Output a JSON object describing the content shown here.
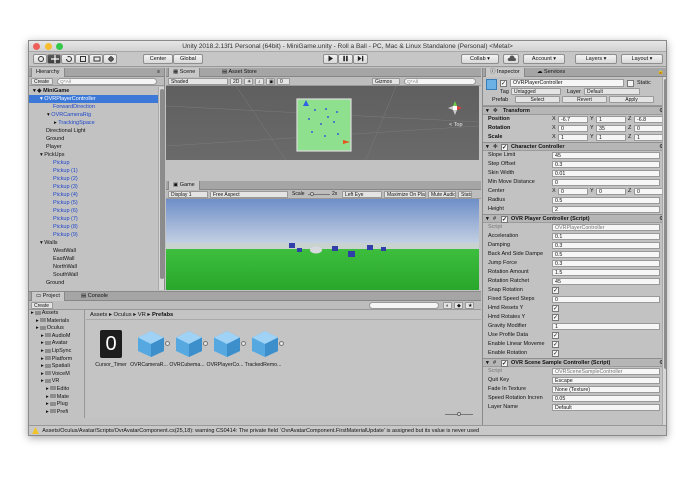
{
  "window": {
    "title": "Unity 2018.2.13f1 Personal (64bit) - MiniGame.unity - Roll a Ball - PC, Mac & Linux Standalone (Personal) <Metal>",
    "colors": {
      "close": "#ee5f58",
      "minimize": "#f8bd2e",
      "maximize": "#34c84a"
    }
  },
  "toolbar": {
    "center": "Center",
    "global": "Global",
    "collab": "Collab",
    "account": "Account",
    "layers": "Layers",
    "layout": "Layout"
  },
  "hierarchy": {
    "tab": "Hierarchy",
    "create": "Create",
    "search_placeholder": "Q*All",
    "items": [
      {
        "label": "MiniGame",
        "indent": 0,
        "style": "scene"
      },
      {
        "label": "OVRPlayerController",
        "indent": 1,
        "style": "selected"
      },
      {
        "label": "ForwardDirection",
        "indent": 2,
        "style": "blue"
      },
      {
        "label": "OVRCameraRig",
        "indent": 2,
        "style": "blue"
      },
      {
        "label": "TrackingSpace",
        "indent": 3,
        "style": "blue"
      },
      {
        "label": "Directional Light",
        "indent": 1,
        "style": "normal"
      },
      {
        "label": "Ground",
        "indent": 1,
        "style": "normal"
      },
      {
        "label": "Player",
        "indent": 1,
        "style": "normal"
      },
      {
        "label": "PickUps",
        "indent": 1,
        "style": "normal"
      },
      {
        "label": "Pickup",
        "indent": 2,
        "style": "blue"
      },
      {
        "label": "Pickup (1)",
        "indent": 2,
        "style": "blue"
      },
      {
        "label": "Pickup (2)",
        "indent": 2,
        "style": "blue"
      },
      {
        "label": "Pickup (3)",
        "indent": 2,
        "style": "blue"
      },
      {
        "label": "Pickup (4)",
        "indent": 2,
        "style": "blue"
      },
      {
        "label": "Pickup (5)",
        "indent": 2,
        "style": "blue"
      },
      {
        "label": "Pickup (6)",
        "indent": 2,
        "style": "blue"
      },
      {
        "label": "Pickup (7)",
        "indent": 2,
        "style": "blue"
      },
      {
        "label": "Pickup (8)",
        "indent": 2,
        "style": "blue"
      },
      {
        "label": "Pickup (9)",
        "indent": 2,
        "style": "blue"
      },
      {
        "label": "Walls",
        "indent": 1,
        "style": "normal"
      },
      {
        "label": "WestWall",
        "indent": 2,
        "style": "normal"
      },
      {
        "label": "EastWall",
        "indent": 2,
        "style": "normal"
      },
      {
        "label": "NorthWall",
        "indent": 2,
        "style": "normal"
      },
      {
        "label": "SouthWall",
        "indent": 2,
        "style": "normal"
      },
      {
        "label": "Ground",
        "indent": 1,
        "style": "normal"
      }
    ]
  },
  "scene": {
    "tab_scene": "Scene",
    "tab_asset_store": "Asset Store",
    "shading": "Shaded",
    "mode_2d": "2D",
    "gizmos": "Gizmos",
    "search_placeholder": "Q*All",
    "gizmo_label": "< Top"
  },
  "game": {
    "tab": "Game",
    "display": "Display 1",
    "aspect": "Free Aspect",
    "scale_label": "Scale",
    "scale_value": "2x",
    "left_eye": "Left Eye",
    "maximize": "Maximize On Play",
    "mute": "Mute Audio",
    "stats": "Stats"
  },
  "project": {
    "tab_project": "Project",
    "tab_console": "Console",
    "create": "Create",
    "tree": [
      {
        "label": "Assets",
        "indent": 0
      },
      {
        "label": "Materials",
        "indent": 1
      },
      {
        "label": "Oculus",
        "indent": 1
      },
      {
        "label": "AudioM",
        "indent": 2
      },
      {
        "label": "Avatar",
        "indent": 2
      },
      {
        "label": "LipSync",
        "indent": 2
      },
      {
        "label": "Platform",
        "indent": 2
      },
      {
        "label": "Spatiali",
        "indent": 2
      },
      {
        "label": "VoiceM",
        "indent": 2
      },
      {
        "label": "VR",
        "indent": 2
      },
      {
        "label": "Edito",
        "indent": 3
      },
      {
        "label": "Mate",
        "indent": 3
      },
      {
        "label": "Plug",
        "indent": 3
      },
      {
        "label": "Prefi",
        "indent": 3
      }
    ],
    "breadcrumb": [
      "Assets",
      "Oculus",
      "VR",
      "Prefabs"
    ],
    "assets": [
      {
        "label": "Cursor_Timer",
        "icon": "timer-icon"
      },
      {
        "label": "OVRCameraR...",
        "icon": "prefab-cube-icon"
      },
      {
        "label": "OVRCubema...",
        "icon": "prefab-cube-icon"
      },
      {
        "label": "OVRPlayerCo...",
        "icon": "prefab-cube-icon"
      },
      {
        "label": "TrackedRemo...",
        "icon": "prefab-cube-icon"
      }
    ],
    "timer_glyph": "0"
  },
  "inspector": {
    "tab_inspector": "Inspector",
    "tab_services": "Services",
    "object_name": "OVRPlayerController",
    "static_label": "Static",
    "tag_label": "Tag",
    "tag_value": "Untagged",
    "layer_label": "Layer",
    "layer_value": "Default",
    "prefab_label": "Prefab",
    "select": "Select",
    "revert": "Revert",
    "apply": "Apply",
    "transform": {
      "title": "Transform",
      "position_label": "Position",
      "rotation_label": "Rotation",
      "scale_label": "Scale",
      "position": {
        "x": "-6.7",
        "y": "1",
        "z": "-6.8"
      },
      "rotation": {
        "x": "0",
        "y": "35",
        "z": "0"
      },
      "scale": {
        "x": "1",
        "y": "1",
        "z": "1"
      }
    },
    "character_controller": {
      "title": "Character Controller",
      "props": [
        {
          "label": "Slope Limit",
          "value": "45"
        },
        {
          "label": "Step Offset",
          "value": "0.3"
        },
        {
          "label": "Skin Width",
          "value": "0.01"
        },
        {
          "label": "Min Move Distance",
          "value": "0"
        }
      ],
      "center_label": "Center",
      "center": {
        "x": "0",
        "y": "0",
        "z": "0"
      },
      "props2": [
        {
          "label": "Radius",
          "value": "0.5"
        },
        {
          "label": "Height",
          "value": "2"
        }
      ]
    },
    "ovr_player_controller": {
      "title": "OVR Player Controller (Script)",
      "script_label": "Script",
      "script_value": "OVRPlayerController",
      "props": [
        {
          "label": "Acceleration",
          "value": "0.1"
        },
        {
          "label": "Damping",
          "value": "0.3"
        },
        {
          "label": "Back And Side Dampe",
          "value": "0.5"
        },
        {
          "label": "Jump Force",
          "value": "0.3"
        },
        {
          "label": "Rotation Amount",
          "value": "1.5"
        },
        {
          "label": "Rotation Ratchet",
          "value": "45"
        }
      ],
      "checks": [
        {
          "label": "Snap Rotation",
          "checked": true
        },
        {
          "label": "Fixed Speed Steps",
          "value": "0"
        },
        {
          "label": "Hmd Resets Y",
          "checked": true
        },
        {
          "label": "Hmd Rotates Y",
          "checked": true
        },
        {
          "label": "Gravity Modifier",
          "value": "1"
        },
        {
          "label": "Use Profile Data",
          "checked": true
        },
        {
          "label": "Enable Linear Moveme",
          "checked": true
        },
        {
          "label": "Enable Rotation",
          "checked": true
        }
      ]
    },
    "ovr_scene_sample": {
      "title": "OVR Scene Sample Controller (Script)",
      "script_label": "Script",
      "script_value": "OVRSceneSampleController",
      "props": [
        {
          "label": "Quit Key",
          "value": "Escape"
        },
        {
          "label": "Fade In Texture",
          "value": "None (Texture)"
        },
        {
          "label": "Speed Rotation Incren",
          "value": "0.05"
        },
        {
          "label": "Layer Name",
          "value": "Default"
        }
      ]
    }
  },
  "status": {
    "message": "Assets/Oculus/Avatar/Scripts/OvrAvatarComponent.cs(25,18): warning CS0414: The private field `OvrAvatarComponent.FirstMaterialUpdate' is assigned but its value is never used"
  }
}
